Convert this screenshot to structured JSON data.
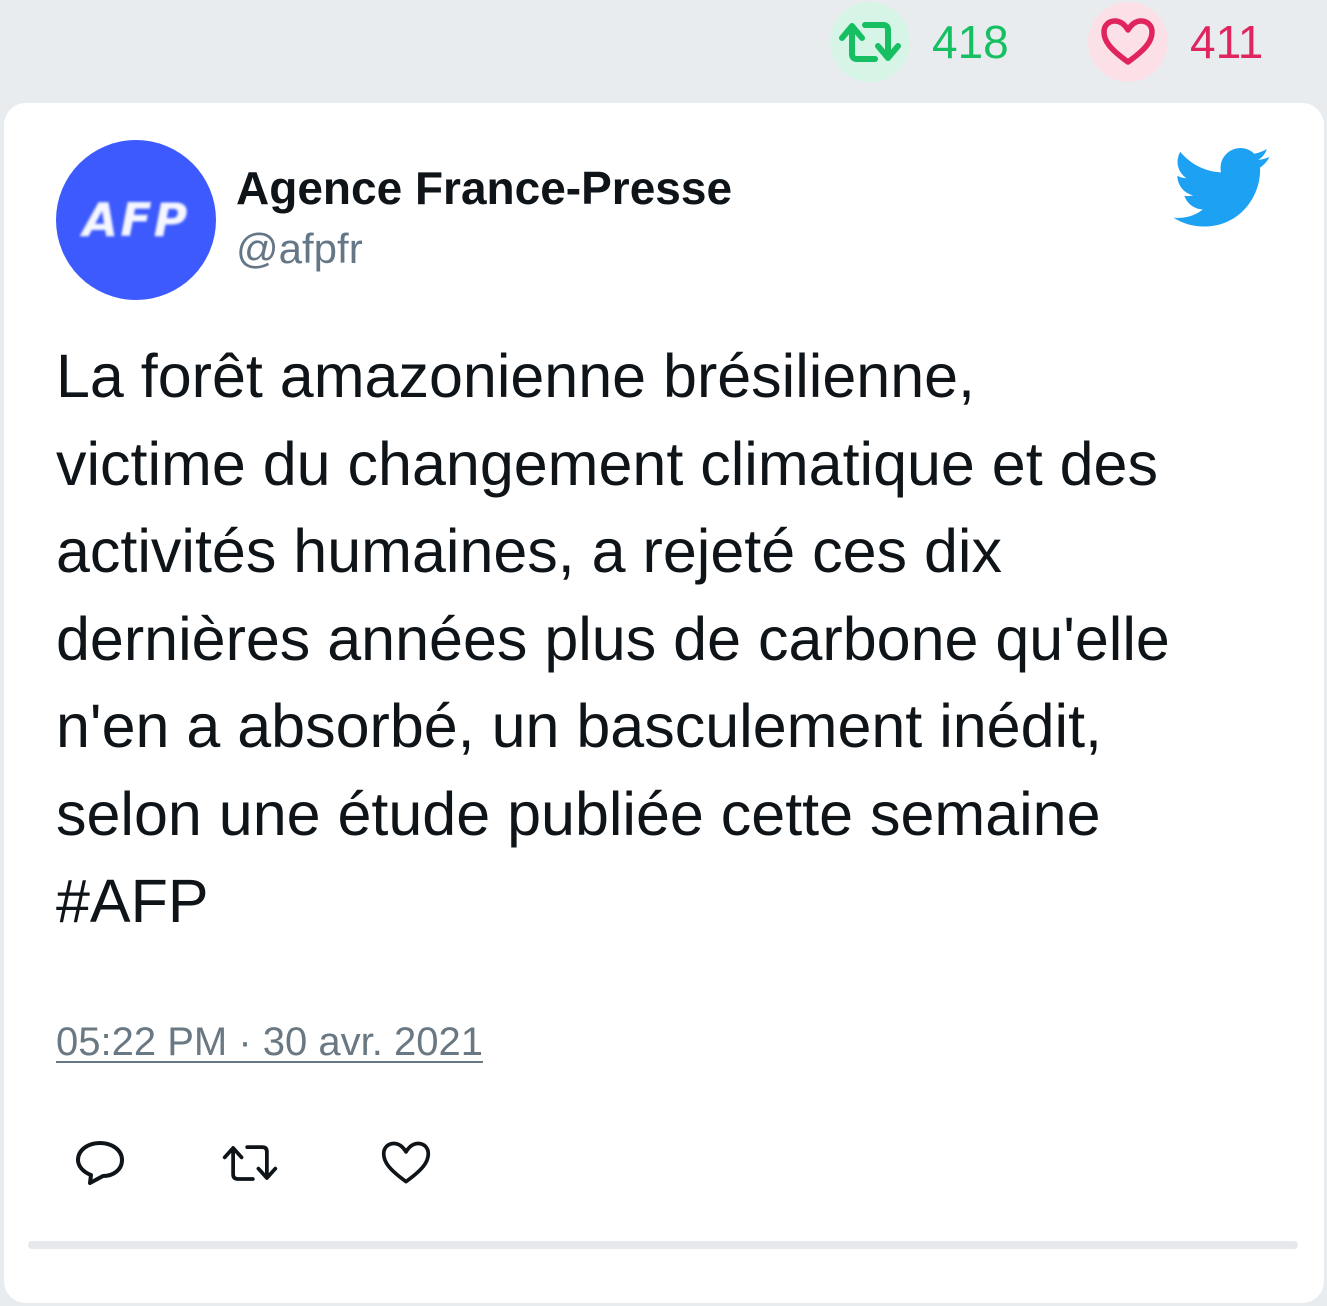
{
  "stats": {
    "retweet_count": "418",
    "like_count": "411"
  },
  "tweet": {
    "author": {
      "avatar_text": "AFP",
      "name": "Agence France-Presse",
      "handle": "@afpfr"
    },
    "text": "La forêt amazonienne brésilienne,\nvictime du changement climatique et des\nactivités humaines, a rejeté ces dix\ndernières années plus de carbone qu'elle\nn'en a absorbé, un basculement inédit,\nselon une étude publiée cette semaine\n#AFP",
    "timestamp": "05:22 PM · 30 avr. 2021"
  },
  "icons": {
    "top_retweet": "retweet-icon",
    "top_like": "heart-icon",
    "brand": "twitter-bird-icon",
    "action_reply": "reply-icon",
    "action_retweet": "retweet-icon",
    "action_like": "heart-icon"
  },
  "colors": {
    "retweet_green": "#17bf63",
    "like_red": "#e0245e",
    "twitter_blue": "#1da1f2",
    "avatar_blue": "#3d5afe",
    "text_dark": "#0f1419",
    "text_gray": "#657786"
  }
}
